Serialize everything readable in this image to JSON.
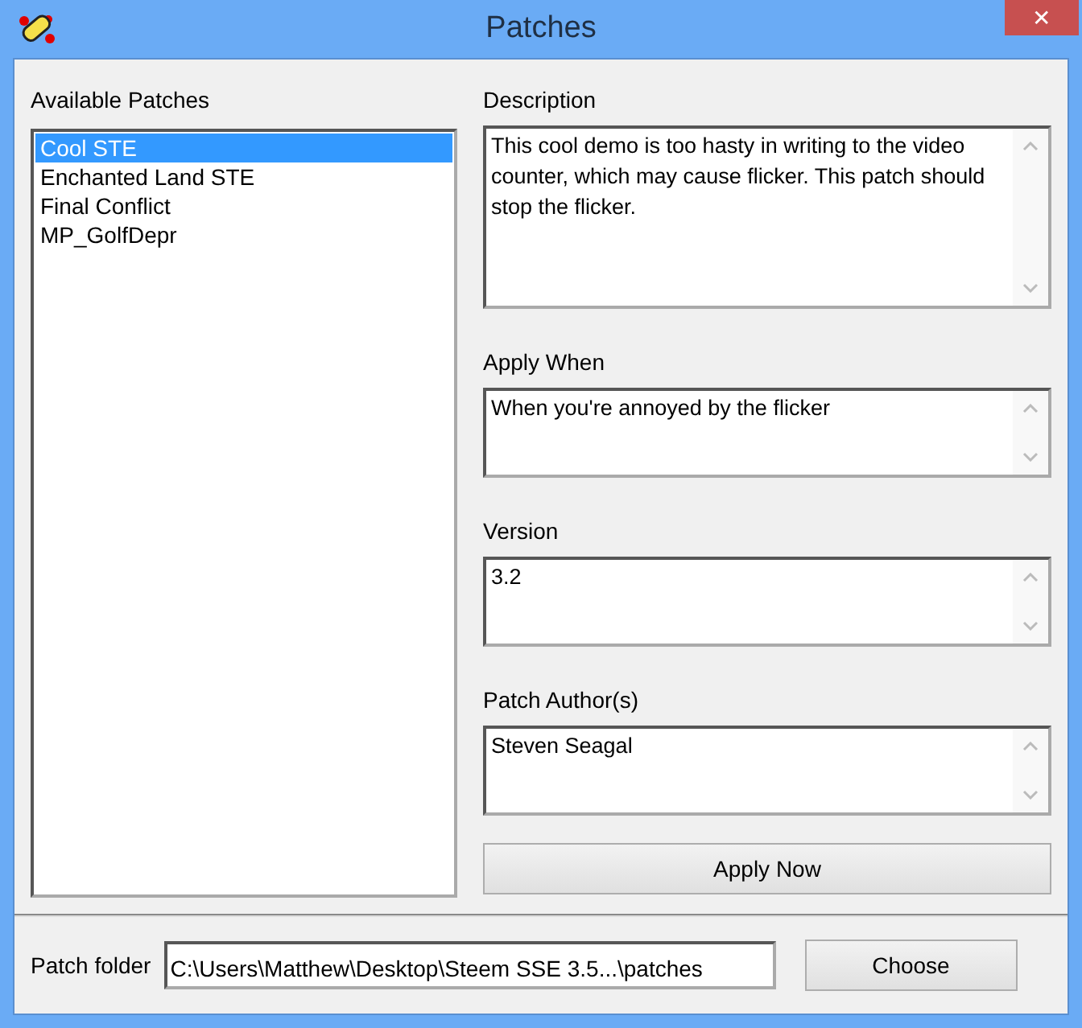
{
  "window": {
    "title": "Patches",
    "close": "✕"
  },
  "patches": {
    "label": "Available Patches",
    "items": [
      {
        "name": "Cool STE",
        "selected": true
      },
      {
        "name": "Enchanted Land STE",
        "selected": false
      },
      {
        "name": "Final Conflict",
        "selected": false
      },
      {
        "name": "MP_GolfDepr",
        "selected": false
      }
    ]
  },
  "fields": [
    {
      "label": "Description",
      "value": "This cool demo is too hasty in writing to the video counter, which may cause flicker. This patch should stop the flicker."
    },
    {
      "label": "Apply When",
      "value": "When you're annoyed by the flicker"
    },
    {
      "label": "Version",
      "value": "3.2"
    },
    {
      "label": "Patch Author(s)",
      "value": "Steven Seagal"
    }
  ],
  "apply_button": "Apply Now",
  "folder": {
    "label": "Patch folder",
    "value": "C:\\Users\\Matthew\\Desktop\\Steem SSE 3.5...\\patches",
    "button": "Choose"
  }
}
